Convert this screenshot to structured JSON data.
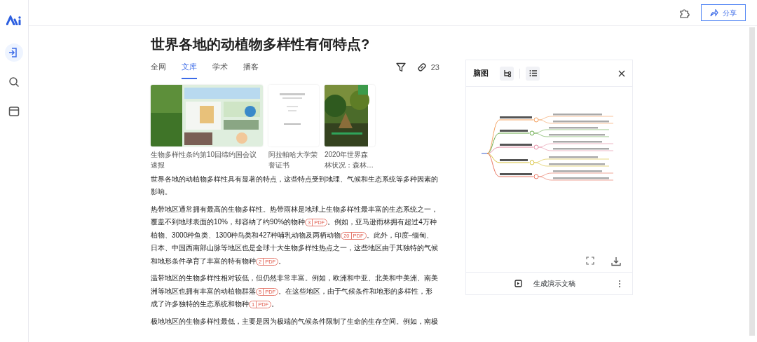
{
  "sidebar": {
    "items": [
      {
        "kind": "login",
        "selected": true
      },
      {
        "kind": "search",
        "selected": false
      },
      {
        "kind": "window",
        "selected": false
      }
    ]
  },
  "header": {
    "share_button": "分享"
  },
  "question": {
    "title": "世界各地的动植物多样性有何特点?"
  },
  "tabs": [
    {
      "label": "全网",
      "selected": false
    },
    {
      "label": "文库",
      "selected": true
    },
    {
      "label": "学术",
      "selected": false
    },
    {
      "label": "播客",
      "selected": false
    }
  ],
  "sources_count": "23",
  "documents": [
    {
      "kind": "poster",
      "caption": "生物多样性条约第10回缔约国会议速报"
    },
    {
      "kind": "paper",
      "caption": "阿拉帕哈大学荣誉证书"
    },
    {
      "kind": "forest",
      "caption": "2020年世界森林状况：森林…"
    }
  ],
  "answer": {
    "paragraphs": [
      [
        {
          "kind": "text",
          "text": "世界各地的动植物多样性具有显著的特点，这些特点受到地理、气候和生态系统等多种因素的影响。"
        }
      ],
      [
        {
          "kind": "text",
          "text": "热带地区通常拥有最高的生物多样性。热带雨林是地球上生物多样性最丰富的生态系统之一，覆盖不到地球表面的10%，却容纳了约90%的物种"
        },
        {
          "kind": "cite",
          "number": "3",
          "label": "PDF"
        },
        {
          "kind": "text",
          "text": "。例如，亚马逊雨林拥有超过4万种植物、3000种鱼类、1300种鸟类和427种哺乳动物及两栖动物"
        },
        {
          "kind": "cite",
          "number": "20",
          "label": "PDF"
        },
        {
          "kind": "text",
          "text": "。此外，印度–缅甸、日本、中国西南部山脉等地区也是全球十大生物多样性热点之一，这些地区由于其独特的气候和地形条件孕育了丰富的特有物种"
        },
        {
          "kind": "cite",
          "number": "2",
          "label": "PDF"
        },
        {
          "kind": "text",
          "text": "。"
        }
      ],
      [
        {
          "kind": "text",
          "text": "温带地区的生物多样性相对较低，但仍然非常丰富。例如，欧洲和中亚、北美和中美洲、南美洲等地区也拥有丰富的动植物群落"
        },
        {
          "kind": "cite",
          "number": "5",
          "label": "PDF"
        },
        {
          "kind": "text",
          "text": "。在这些地区，由于气候条件和地形的多样性，形成了许多独特的生态系统和物种"
        },
        {
          "kind": "cite",
          "number": "1",
          "label": "PDF"
        },
        {
          "kind": "text",
          "text": "。"
        }
      ],
      [
        {
          "kind": "text",
          "text": "极地地区的生物多样性最低，主要是因为极端的气候条件限制了生命的生存空间。例如，南极"
        }
      ]
    ]
  },
  "mindmap_panel": {
    "title": "脑图",
    "views": [
      {
        "kind": "mindmap"
      },
      {
        "kind": "list"
      }
    ],
    "action": "生成演示文稿"
  }
}
